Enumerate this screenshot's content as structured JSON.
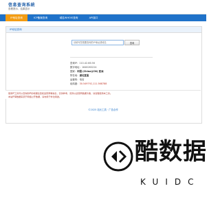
{
  "header": {
    "site_name": "信息查询系统",
    "tagline": "查看提示、结果显示"
  },
  "nav": {
    "items": [
      {
        "label": "IP地址查询",
        "active": true
      },
      {
        "label": "ICP备案查询",
        "active": false
      },
      {
        "label": "域名WHOIS查询",
        "active": false
      },
      {
        "label": "API接口",
        "active": false
      }
    ]
  },
  "panel": {
    "title": "IP地址查询",
    "search": {
      "placeholder": "请填写您需要查询的IP地址或域名",
      "button_label": "查询"
    },
    "result": [
      {
        "key": "查询IP：",
        "value": "110.42.66.56",
        "style": ""
      },
      {
        "key": "数字地址：",
        "value": "1848263224",
        "style": ""
      },
      {
        "key": "国家：",
        "value": "中国 (China)(CN) 亚洲",
        "style": "strong"
      },
      {
        "key": "所在地：",
        "value": "湖北宜昌",
        "style": "strong"
      },
      {
        "key": "运营商：",
        "value": "电信",
        "style": ""
      },
      {
        "key": "经纬度：",
        "value": "30.549792,111.568788",
        "style": "red"
      }
    ]
  },
  "note": {
    "lines": [
      "使用IP工具可以查询到IP的地理位置和运营商等信息，仅供参考，实际以运营商数据为准，请合理使用本工具。",
      "本站IP库数据来源于网络公开数据，请勿用于非法用途。"
    ]
  },
  "footer": {
    "copyright": "©2025 站长工具 · 广告合作"
  },
  "watermark": {
    "title": "酷数据",
    "subtitle": "KUIDC"
  },
  "colors": {
    "nav_bg": "#1f72c9",
    "nav_active": "#f39c12",
    "accent": "#1f72c9"
  }
}
